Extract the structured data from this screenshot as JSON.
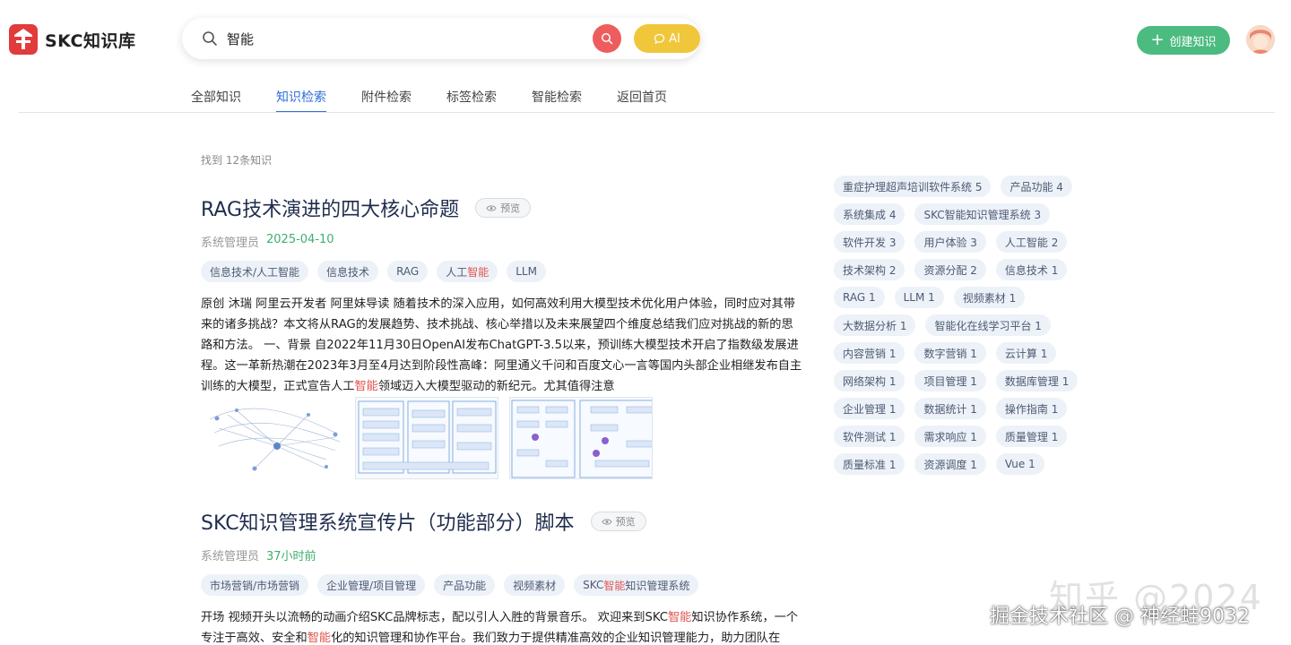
{
  "app": {
    "name": "SKC知识库"
  },
  "search": {
    "query": "智能",
    "ai_label": "AI"
  },
  "header": {
    "create_label": "创建知识"
  },
  "tabs": [
    "全部知识",
    "知识检索",
    "附件检索",
    "标签检索",
    "智能检索",
    "返回首页"
  ],
  "active_tab": 1,
  "results": {
    "count_text": "找到 12条知识"
  },
  "articles": [
    {
      "title": "RAG技术演进的四大核心命题",
      "preview_label": "预览",
      "author": "系统管理员",
      "date": "2025-04-10",
      "tags": [
        "信息技术/人工智能",
        "信息技术",
        "RAG",
        "人工智能",
        "LLM"
      ],
      "summary": "原创 沐瑞 阿里云开发者 阿里妹导读 随着技术的深入应用，如何高效利用大模型技术优化用户体验，同时应对其带来的诸多挑战？本文将从RAG的发展趋势、技术挑战、核心举措以及未来展望四个维度总结我们应对挑战的新的思路和方法。 一、背景 自2022年11月30日OpenAI发布ChatGPT-3.5以来，预训练大模型技术开启了指数级发展进程。这一革新热潮在2023年3月至4月达到阶段性高峰：阿里通义千问和百度文心一言等国内头部企业相继发布自主训练的大模型，正式宣告人工智能领域迈入大模型驱动的新纪元。尤其值得注意"
    },
    {
      "title": "SKC知识管理系统宣传片（功能部分）脚本",
      "preview_label": "预览",
      "author": "系统管理员",
      "date": "37小时前",
      "tags": [
        "市场营销/市场营销",
        "企业管理/项目管理",
        "产品功能",
        "视频素材",
        "SKC智能知识管理系统"
      ],
      "summary": "开场 视频开头以流畅的动画介绍SKC品牌标志，配以引人入胜的背景音乐。 欢迎来到SKC智能知识协作系统，一个专注于高效、安全和智能化的知识管理和协作平台。我们致力于提供精准高效的企业知识管理能力，助力团队在"
    }
  ],
  "tag_cloud": [
    "重症护理超声培训软件系统 5",
    "产品功能 4",
    "系统集成 4",
    "SKC智能知识管理系统 3",
    "软件开发 3",
    "用户体验 3",
    "人工智能 2",
    "技术架构 2",
    "资源分配 2",
    "信息技术 1",
    "RAG 1",
    "LLM 1",
    "视频素材 1",
    "大数据分析 1",
    "智能化在线学习平台 1",
    "内容营销 1",
    "数字营销 1",
    "云计算 1",
    "网络架构 1",
    "项目管理 1",
    "数据库管理 1",
    "企业管理 1",
    "数据统计 1",
    "操作指南 1",
    "软件测试 1",
    "需求响应 1",
    "质量管理 1",
    "质量标准 1",
    "资源调度 1",
    "Vue 1"
  ],
  "watermark": {
    "line1": "知乎 @2024",
    "line2": "掘金技术社区 @ 神经蛙9032"
  },
  "colors": {
    "primary": "#2f6fd6",
    "create_green": "#4cbb7f",
    "search_red": "#ee5d5d",
    "ai_yellow": "#f0c63b",
    "highlight": "#e0554f"
  }
}
